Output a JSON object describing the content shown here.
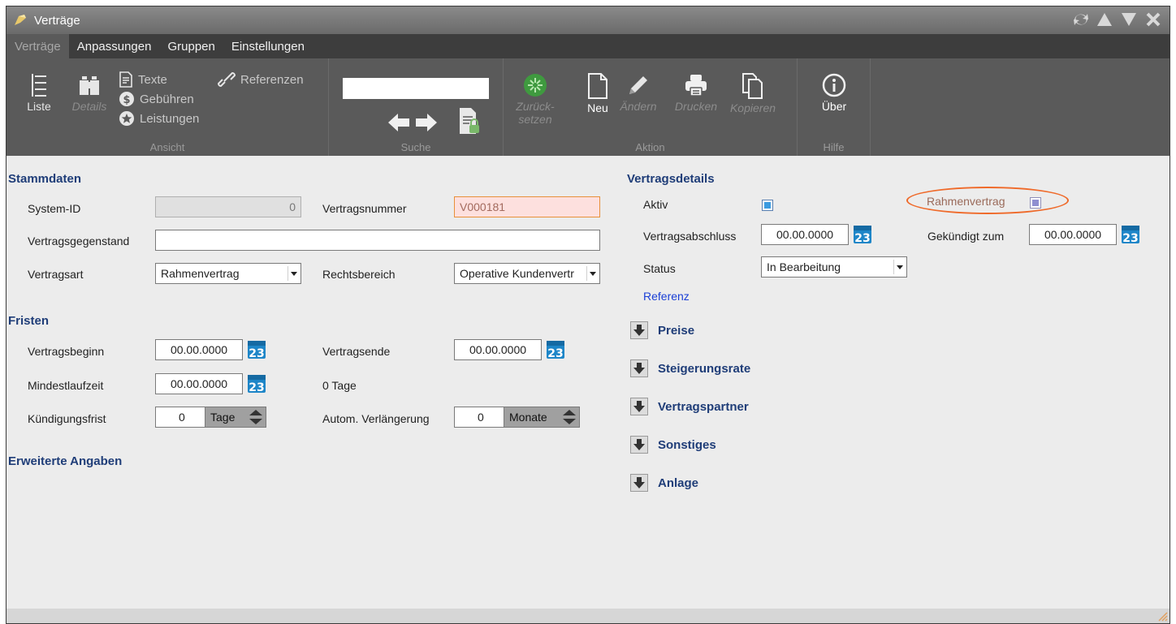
{
  "window": {
    "title": "Verträge"
  },
  "menu": [
    {
      "label": "Verträge",
      "active": true
    },
    {
      "label": "Anpassungen"
    },
    {
      "label": "Gruppen"
    },
    {
      "label": "Einstellungen"
    }
  ],
  "ribbon": {
    "ansicht": {
      "label": "Ansicht",
      "liste": "Liste",
      "details": "Details",
      "texte": "Texte",
      "referenzen": "Referenzen",
      "gebuehren": "Gebühren",
      "leistungen": "Leistungen"
    },
    "suche": {
      "label": "Suche",
      "search_value": ""
    },
    "aktion": {
      "label": "Aktion",
      "zurueck_line1": "Zurück-",
      "zurueck_line2": "setzen",
      "neu": "Neu",
      "aendern": "Ändern",
      "drucken": "Drucken",
      "kopieren": "Kopieren"
    },
    "hilfe": {
      "label": "Hilfe",
      "ueber": "Über"
    }
  },
  "stammdaten": {
    "title": "Stammdaten",
    "system_id_label": "System-ID",
    "system_id_value": "0",
    "vertragsnummer_label": "Vertragsnummer",
    "vertragsnummer_value": "V000181",
    "vertragsgegenstand_label": "Vertragsgegenstand",
    "vertragsgegenstand_value": "",
    "vertragsart_label": "Vertragsart",
    "vertragsart_value": "Rahmenvertrag",
    "rechtsbereich_label": "Rechtsbereich",
    "rechtsbereich_value": "Operative Kundenvertr"
  },
  "fristen": {
    "title": "Fristen",
    "vertragsbeginn_label": "Vertragsbeginn",
    "vertragsbeginn_value": "00.00.0000",
    "vertragsende_label": "Vertragsende",
    "vertragsende_value": "00.00.0000",
    "mindestlaufzeit_label": "Mindestlaufzeit",
    "mindestlaufzeit_value": "00.00.0000",
    "tage_text": "0 Tage",
    "kuendigungsfrist_label": "Kündigungsfrist",
    "kuendigungsfrist_value": "0",
    "kuendigungsfrist_unit": "Tage",
    "verlaengerung_label": "Autom. Verlängerung",
    "verlaengerung_value": "0",
    "verlaengerung_unit": "Monate"
  },
  "erweitert": {
    "title": "Erweiterte Angaben"
  },
  "vertragsdetails": {
    "title": "Vertragsdetails",
    "aktiv_label": "Aktiv",
    "rahmenvertrag_label": "Rahmenvertrag",
    "vertragsabschluss_label": "Vertragsabschluss",
    "vertragsabschluss_value": "00.00.0000",
    "gekuendigt_label": "Gekündigt zum",
    "gekuendigt_value": "00.00.0000",
    "status_label": "Status",
    "status_value": "In Bearbeitung",
    "referenz_link": "Referenz"
  },
  "expanders": [
    "Preise",
    "Steigerungsrate",
    "Vertragspartner",
    "Sonstiges",
    "Anlage"
  ],
  "calendar_day": "23",
  "colors": {
    "accent_blue": "#1f3d78",
    "checkbox_checked": "#3b9be0",
    "checkbox_disabled": "#8f8fd0",
    "highlight": "#ef6a2a",
    "error_bg": "#fde0de"
  }
}
